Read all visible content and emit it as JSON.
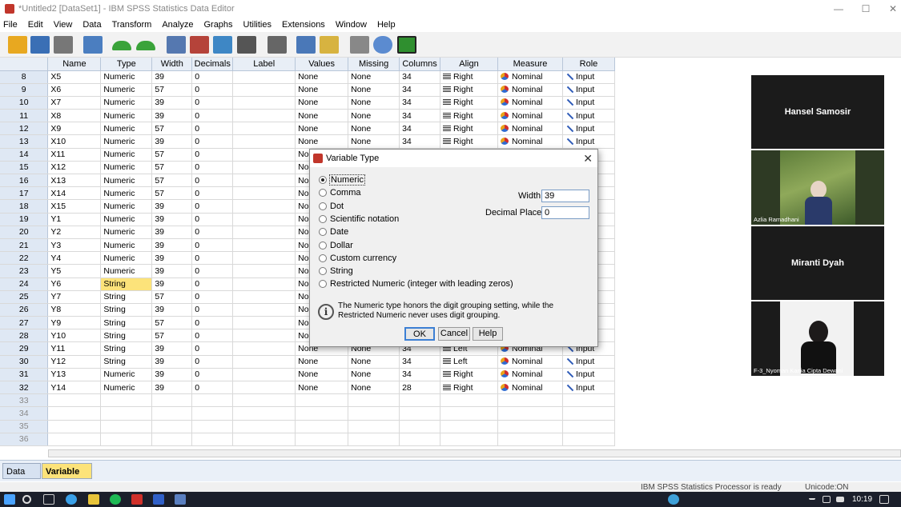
{
  "window": {
    "title": "*Untitled2 [DataSet1] - IBM SPSS Statistics Data Editor",
    "min": "—",
    "max": "☐",
    "close": "✕"
  },
  "menu": [
    "File",
    "Edit",
    "View",
    "Data",
    "Transform",
    "Analyze",
    "Graphs",
    "Utilities",
    "Extensions",
    "Window",
    "Help"
  ],
  "toolbar": [
    "open-icon",
    "save-icon",
    "print-icon",
    "recall-dialog-icon",
    "undo-icon",
    "redo-icon",
    "goto-case-icon",
    "insert-cases-icon",
    "insert-variable-icon",
    "split-file-icon",
    "find-icon",
    "grid-icon",
    "value-labels-icon",
    "chart-icon",
    "spell-icon",
    "add-icon"
  ],
  "grid": {
    "headers": [
      "",
      "Name",
      "Type",
      "Width",
      "Decimals",
      "Label",
      "Values",
      "Missing",
      "Columns",
      "Align",
      "Measure",
      "Role"
    ],
    "rows": [
      [
        "8",
        "X5",
        "Numeric",
        "39",
        "0",
        "",
        "None",
        "None",
        "34",
        "Right",
        "Nominal",
        "Input"
      ],
      [
        "9",
        "X6",
        "Numeric",
        "57",
        "0",
        "",
        "None",
        "None",
        "34",
        "Right",
        "Nominal",
        "Input"
      ],
      [
        "10",
        "X7",
        "Numeric",
        "39",
        "0",
        "",
        "None",
        "None",
        "34",
        "Right",
        "Nominal",
        "Input"
      ],
      [
        "11",
        "X8",
        "Numeric",
        "39",
        "0",
        "",
        "None",
        "None",
        "34",
        "Right",
        "Nominal",
        "Input"
      ],
      [
        "12",
        "X9",
        "Numeric",
        "57",
        "0",
        "",
        "None",
        "None",
        "34",
        "Right",
        "Nominal",
        "Input"
      ],
      [
        "13",
        "X10",
        "Numeric",
        "39",
        "0",
        "",
        "None",
        "None",
        "34",
        "Right",
        "Nominal",
        "Input"
      ],
      [
        "14",
        "X11",
        "Numeric",
        "57",
        "0",
        "",
        "No",
        "",
        "",
        "",
        "",
        ""
      ],
      [
        "15",
        "X12",
        "Numeric",
        "57",
        "0",
        "",
        "No",
        "",
        "",
        "",
        "",
        ""
      ],
      [
        "16",
        "X13",
        "Numeric",
        "57",
        "0",
        "",
        "No",
        "",
        "",
        "",
        "",
        ""
      ],
      [
        "17",
        "X14",
        "Numeric",
        "57",
        "0",
        "",
        "No",
        "",
        "",
        "",
        "",
        ""
      ],
      [
        "18",
        "X15",
        "Numeric",
        "39",
        "0",
        "",
        "No",
        "",
        "",
        "",
        "",
        ""
      ],
      [
        "19",
        "Y1",
        "Numeric",
        "39",
        "0",
        "",
        "No",
        "",
        "",
        "",
        "",
        ""
      ],
      [
        "20",
        "Y2",
        "Numeric",
        "39",
        "0",
        "",
        "No",
        "",
        "",
        "",
        "",
        ""
      ],
      [
        "21",
        "Y3",
        "Numeric",
        "39",
        "0",
        "",
        "No",
        "",
        "",
        "",
        "",
        ""
      ],
      [
        "22",
        "Y4",
        "Numeric",
        "39",
        "0",
        "",
        "No",
        "",
        "",
        "",
        "",
        ""
      ],
      [
        "23",
        "Y5",
        "Numeric",
        "39",
        "0",
        "",
        "No",
        "",
        "",
        "",
        "",
        ""
      ],
      [
        "24",
        "Y6",
        "String",
        "39",
        "0",
        "",
        "No",
        "",
        "",
        "",
        "",
        ""
      ],
      [
        "25",
        "Y7",
        "String",
        "57",
        "0",
        "",
        "No",
        "",
        "",
        "",
        "",
        ""
      ],
      [
        "26",
        "Y8",
        "String",
        "39",
        "0",
        "",
        "No",
        "",
        "",
        "",
        "",
        ""
      ],
      [
        "27",
        "Y9",
        "String",
        "57",
        "0",
        "",
        "No",
        "",
        "",
        "",
        "",
        ""
      ],
      [
        "28",
        "Y10",
        "String",
        "57",
        "0",
        "",
        "No",
        "",
        "",
        "",
        "",
        ""
      ],
      [
        "29",
        "Y11",
        "String",
        "39",
        "0",
        "",
        "None",
        "None",
        "34",
        "Left",
        "Nominal",
        "Input"
      ],
      [
        "30",
        "Y12",
        "String",
        "39",
        "0",
        "",
        "None",
        "None",
        "34",
        "Left",
        "Nominal",
        "Input"
      ],
      [
        "31",
        "Y13",
        "Numeric",
        "39",
        "0",
        "",
        "None",
        "None",
        "34",
        "Right",
        "Nominal",
        "Input"
      ],
      [
        "32",
        "Y14",
        "Numeric",
        "39",
        "0",
        "",
        "None",
        "None",
        "28",
        "Right",
        "Nominal",
        "Input"
      ],
      [
        "33",
        "",
        "",
        "",
        "",
        "",
        "",
        "",
        "",
        "",
        "",
        ""
      ],
      [
        "34",
        "",
        "",
        "",
        "",
        "",
        "",
        "",
        "",
        "",
        "",
        ""
      ],
      [
        "35",
        "",
        "",
        "",
        "",
        "",
        "",
        "",
        "",
        "",
        "",
        ""
      ],
      [
        "36",
        "",
        "",
        "",
        "",
        "",
        "",
        "",
        "",
        "",
        "",
        ""
      ]
    ]
  },
  "tabs": {
    "data_view": "Data View",
    "variable_view": "Variable View"
  },
  "status": {
    "processor": "IBM SPSS Statistics Processor is ready",
    "unicode": "Unicode:ON"
  },
  "participants": [
    {
      "name": "Hansel Samosir",
      "caption": ""
    },
    {
      "name": "",
      "caption": "Azlia Ramadhani"
    },
    {
      "name": "Miranti Dyah",
      "caption": ""
    },
    {
      "name": "",
      "caption": "F-3_Nyoman Kania Cipta Dewani"
    }
  ],
  "dialog": {
    "title": "Variable Type",
    "close": "✕",
    "options": [
      "Numeric",
      "Comma",
      "Dot",
      "Scientific notation",
      "Date",
      "Dollar",
      "Custom currency",
      "String",
      "Restricted Numeric (integer with leading zeros)"
    ],
    "selected": "Numeric",
    "width_label": "Width:",
    "width_value": "39",
    "decimals_label": "Decimal Places:",
    "decimals_value": "0",
    "info_icon": "i",
    "info": "The Numeric type honors the digit grouping setting, while the Restricted Numeric never uses digit grouping.",
    "ok": "OK",
    "cancel": "Cancel",
    "help": "Help"
  },
  "taskbar": {
    "clock": "10:19"
  }
}
